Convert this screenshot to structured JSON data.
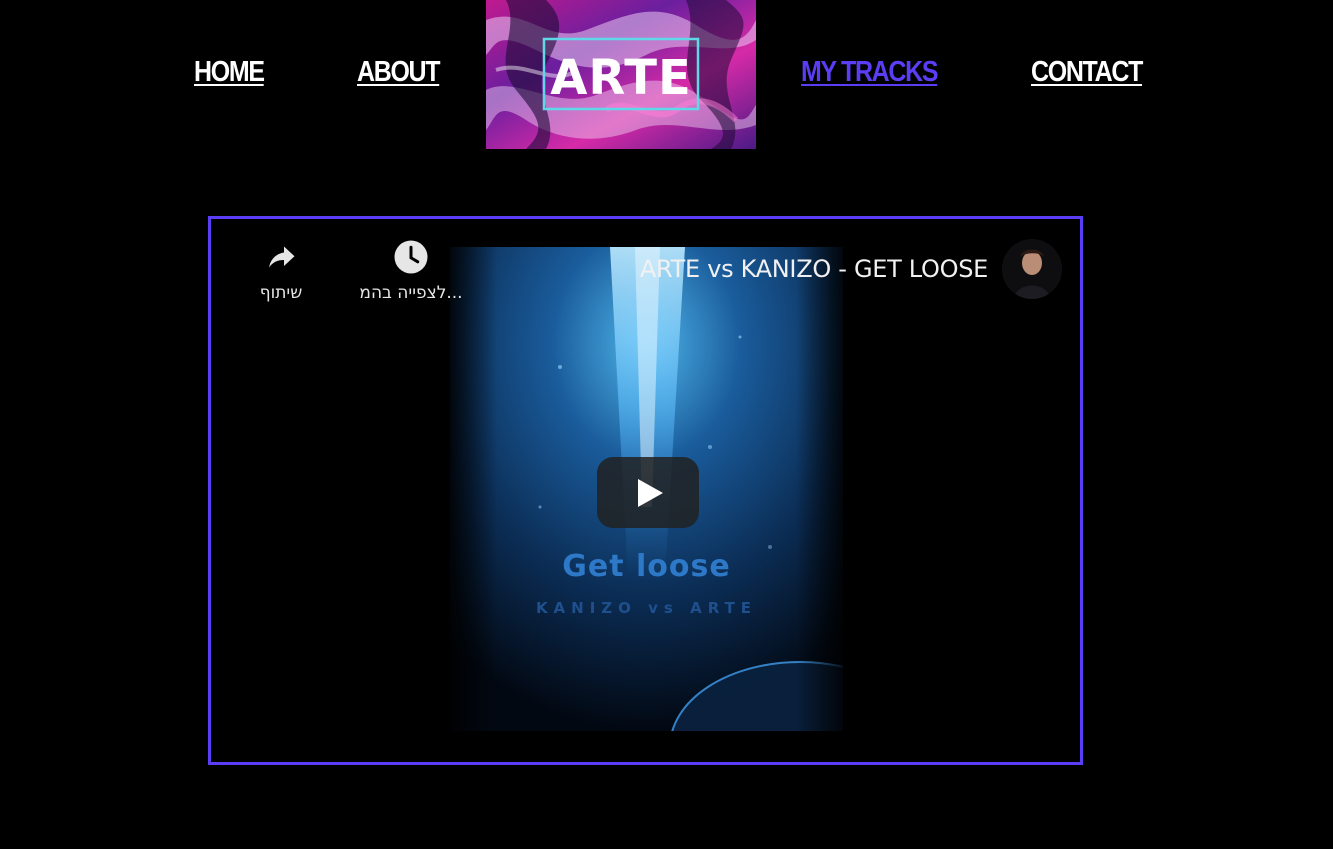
{
  "nav": {
    "home": "HOME",
    "about": "ABOUT",
    "my_tracks": "MY TRACKS",
    "contact": "CONTACT"
  },
  "logo": {
    "text": "ARTE"
  },
  "video": {
    "title": "ARTE vs KANIZO - GET LOOSE",
    "actions": {
      "watch_later": "לצפייה בהמ...",
      "share": "שיתוף"
    },
    "thumbnail": {
      "title": "Get loose",
      "subtitle": "KANIZO vs ARTE"
    }
  },
  "colors": {
    "accent": "#5b3df6",
    "background": "#000000",
    "nav_text": "#ffffff"
  },
  "icons": [
    "share-icon",
    "clock-icon",
    "play-icon",
    "channel-avatar"
  ]
}
